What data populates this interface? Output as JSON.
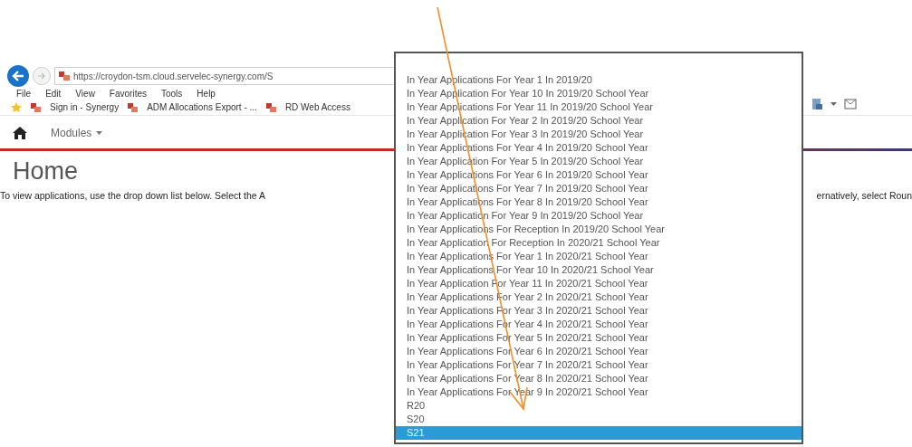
{
  "browser": {
    "address": "https://croydon-tsm.cloud.servelec-synergy.com/S",
    "menu": [
      "File",
      "Edit",
      "View",
      "Favorites",
      "Tools",
      "Help"
    ],
    "favorites": [
      "Sign in - Synergy",
      "ADM Allocations Export - ...",
      "RD Web Access"
    ]
  },
  "nav": {
    "items": [
      "Modules"
    ]
  },
  "page": {
    "title": "Home",
    "text_left": "To view applications, use the drop down list below. Select the A",
    "text_right": "ernatively, select Roun"
  },
  "dropdown": {
    "options": [
      {
        "label": "In Year Applications For Year 1 In 2019/20",
        "selected": false
      },
      {
        "label": "In Year Application For Year 10 In 2019/20 School Year",
        "selected": false
      },
      {
        "label": "In Year Applications For Year 11 In 2019/20 School Year",
        "selected": false
      },
      {
        "label": "In Year Application For Year 2 In 2019/20 School Year",
        "selected": false
      },
      {
        "label": "In Year Application For Year 3 In 2019/20 School Year",
        "selected": false
      },
      {
        "label": "In Year Applications For Year 4 In 2019/20 School Year",
        "selected": false
      },
      {
        "label": "In Year Application For Year 5 In 2019/20 School Year",
        "selected": false
      },
      {
        "label": "In Year Applications For Year 6 In 2019/20 School Year",
        "selected": false
      },
      {
        "label": "In Year Applications For Year 7 In 2019/20 School Year",
        "selected": false
      },
      {
        "label": "In Year Applications For Year 8 In 2019/20 School Year",
        "selected": false
      },
      {
        "label": "In Year Application For Year 9 In 2019/20 School Year",
        "selected": false
      },
      {
        "label": "In Year Applications For Reception In 2019/20 School Year",
        "selected": false
      },
      {
        "label": "In Year Application For Reception In 2020/21 School Year",
        "selected": false
      },
      {
        "label": "In Year Applications For Year 1 In 2020/21 School Year",
        "selected": false
      },
      {
        "label": "In Year Applications For Year 10 In 2020/21 School Year",
        "selected": false
      },
      {
        "label": "In Year Application For Year 11 In 2020/21 School Year",
        "selected": false
      },
      {
        "label": "In Year Applications For Year 2 In 2020/21 School Year",
        "selected": false
      },
      {
        "label": "In Year Applications For Year 3 In 2020/21 School Year",
        "selected": false
      },
      {
        "label": "In Year Applications For Year 4 In 2020/21 School Year",
        "selected": false
      },
      {
        "label": "In Year Applications For Year 5 In 2020/21 School Year",
        "selected": false
      },
      {
        "label": "In Year Applications For Year 6 In 2020/21 School Year",
        "selected": false
      },
      {
        "label": "In Year Applications For Year 7 In 2020/21 School Year",
        "selected": false
      },
      {
        "label": "In Year Applications For Year 8 In 2020/21 School Year",
        "selected": false
      },
      {
        "label": "In Year Applications For Year 9 In 2020/21 School Year",
        "selected": false
      },
      {
        "label": "R20",
        "selected": false
      },
      {
        "label": "S20",
        "selected": false
      },
      {
        "label": "S21",
        "selected": true
      }
    ]
  }
}
